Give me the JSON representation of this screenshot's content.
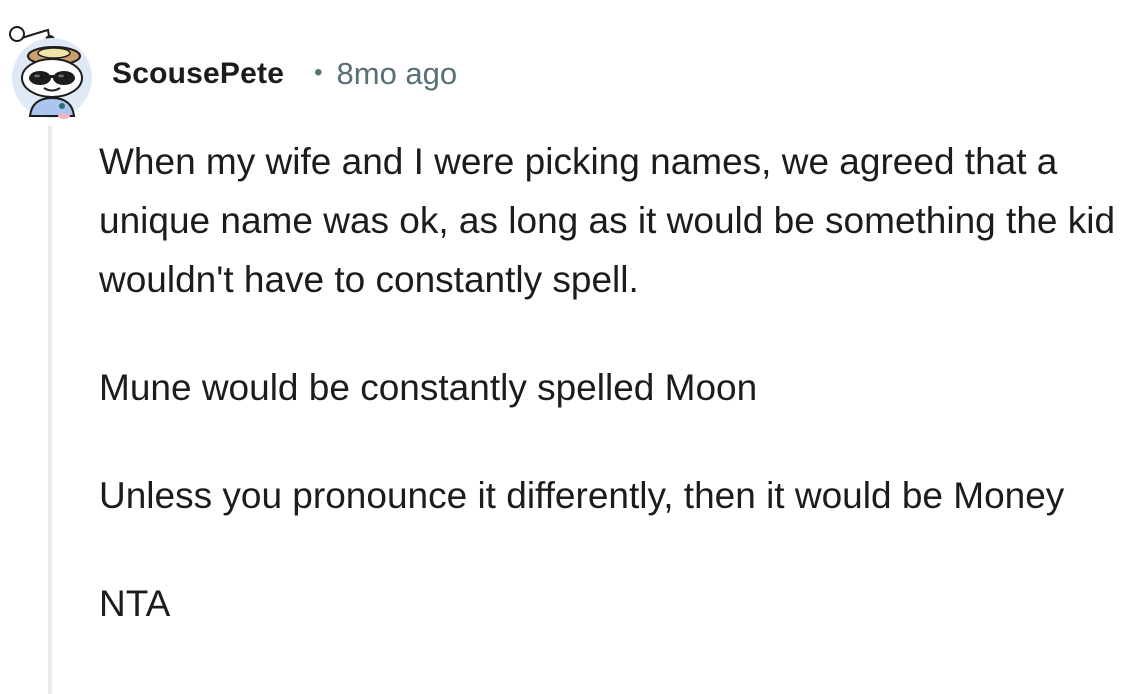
{
  "comment": {
    "author": "ScousePete",
    "separator": "•",
    "timestamp": "8mo ago",
    "avatar_icon": "snoo-avatar-icon",
    "paragraphs": [
      "When my wife and I were picking names, we agreed that a unique name was ok, as long as it would be something the kid wouldn't have to constantly spell.",
      "Mune would be constantly spelled Moon",
      "Unless you pronounce it differently, then it would be Money",
      "NTA"
    ]
  },
  "colors": {
    "text": "#1c1c1c",
    "meta": "#576f76",
    "thread_line": "#e5ebee"
  }
}
